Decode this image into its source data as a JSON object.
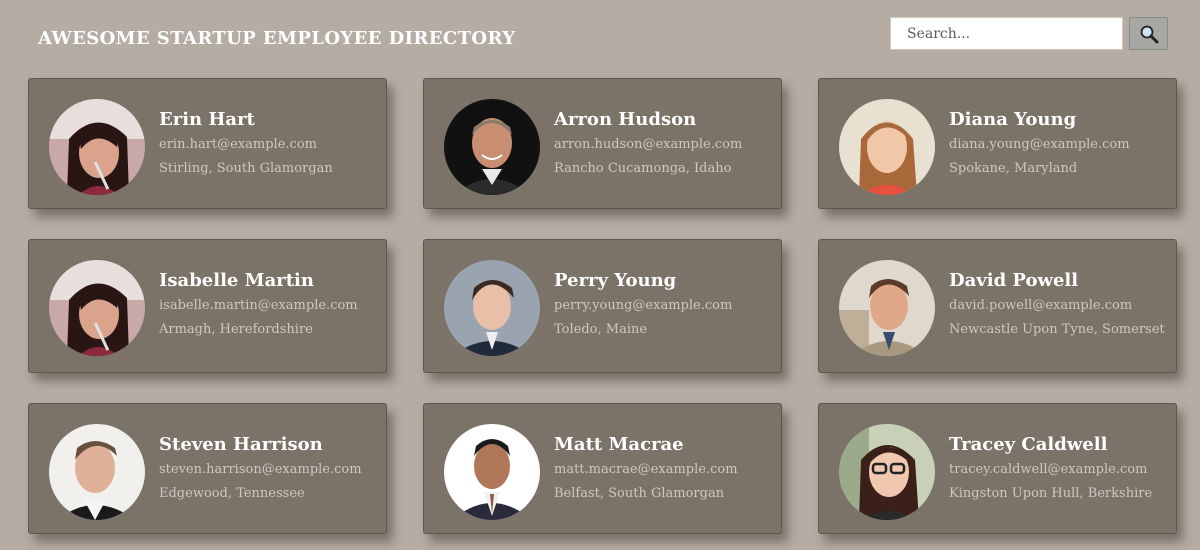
{
  "header": {
    "title": "AWESOME STARTUP EMPLOYEE DIRECTORY",
    "search_placeholder": "Search...",
    "search_icon": "magnifier-icon"
  },
  "employees": [
    {
      "name": "Erin Hart",
      "email": "erin.hart@example.com",
      "location": "Stirling, South Glamorgan",
      "avatar": "woman-dark-hair-photo"
    },
    {
      "name": "Arron Hudson",
      "email": "arron.hudson@example.com",
      "location": "Rancho Cucamonga, Idaho",
      "avatar": "man-grey-hair-photo"
    },
    {
      "name": "Diana Young",
      "email": "diana.young@example.com",
      "location": "Spokane, Maryland",
      "avatar": "woman-light-hair-photo"
    },
    {
      "name": "Isabelle Martin",
      "email": "isabelle.martin@example.com",
      "location": "Armagh, Herefordshire",
      "avatar": "woman-dark-hair-photo"
    },
    {
      "name": "Perry Young",
      "email": "perry.young@example.com",
      "location": "Toledo, Maine",
      "avatar": "young-man-suit-photo"
    },
    {
      "name": "David Powell",
      "email": "david.powell@example.com",
      "location": "Newcastle Upon Tyne, Somerset",
      "avatar": "man-brown-hair-photo"
    },
    {
      "name": "Steven Harrison",
      "email": "steven.harrison@example.com",
      "location": "Edgewood, Tennessee",
      "avatar": "man-white-shirt-photo"
    },
    {
      "name": "Matt Macrae",
      "email": "matt.macrae@example.com",
      "location": "Belfast, South Glamorgan",
      "avatar": "man-suit-photo"
    },
    {
      "name": "Tracey Caldwell",
      "email": "tracey.caldwell@example.com",
      "location": "Kingston Upon Hull, Berkshire",
      "avatar": "woman-glasses-photo"
    }
  ],
  "colors": {
    "page_background": "#b5ada3",
    "card_background": "#7b7268",
    "name_text": "#ffffff",
    "detail_text": "#d0c8bf"
  }
}
